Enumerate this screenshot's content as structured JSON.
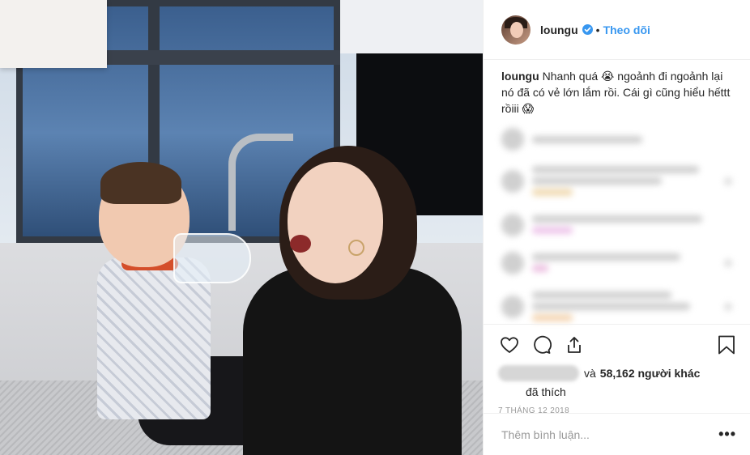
{
  "post": {
    "user": {
      "username": "loungu",
      "verified": true,
      "verified_icon": "verified-badge-icon",
      "follow_label": "Theo dõi",
      "separator": "•"
    },
    "caption": {
      "username": "loungu",
      "text": "Nhanh quá 😭 ngoảnh đi ngoảnh lại nó đã có vẻ lớn lắm rồi. Cái gì cũng hiểu hếttt rồiii 😱"
    },
    "actions": {
      "like_icon": "heart-icon",
      "comment_icon": "comment-bubble-icon",
      "share_icon": "share-icon",
      "save_icon": "bookmark-icon"
    },
    "likes": {
      "connector": "và",
      "count_text": "58,162 người khác",
      "liked_text": "đã thích"
    },
    "date": "7 THÁNG 12 2018",
    "add_comment": {
      "placeholder": "Thêm bình luận...",
      "more_label": "•••"
    }
  },
  "colors": {
    "link_blue": "#3897f0",
    "text": "#262626",
    "muted": "#999999",
    "border": "#efefef"
  }
}
